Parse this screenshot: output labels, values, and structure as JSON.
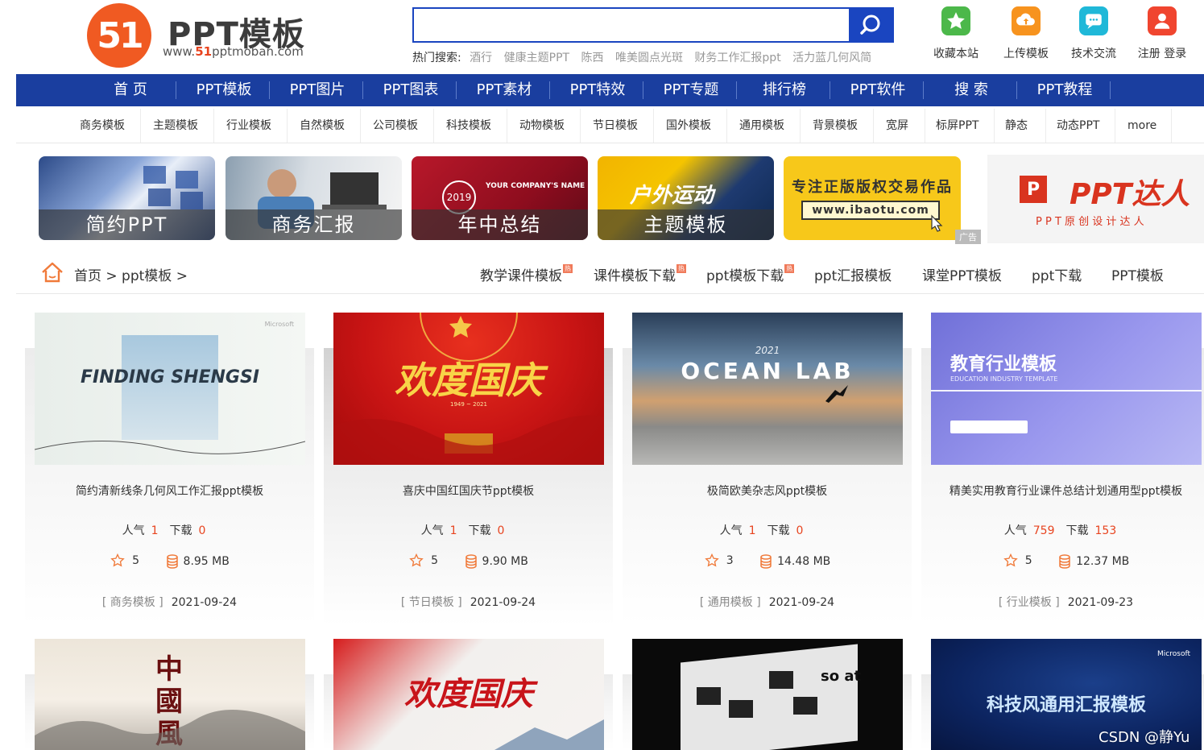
{
  "logo": {
    "mark": "51",
    "title": "PPT模板",
    "url_prefix": "www.",
    "url_highlight": "51",
    "url_suffix": "pptmoban.com"
  },
  "search": {
    "placeholder": "",
    "value": ""
  },
  "hot": {
    "label": "热门搜索:",
    "keywords": [
      "酒行",
      "健康主题PPT",
      "陈西",
      "唯美圆点光斑",
      "财务工作汇报ppt",
      "活力蓝几何风简"
    ]
  },
  "top_links": [
    {
      "label": "收藏本站",
      "icon": "star-icon",
      "color": "#4cb84a"
    },
    {
      "label": "上传模板",
      "icon": "upload-icon",
      "color": "#f7931e"
    },
    {
      "label": "技术交流",
      "icon": "chat-icon",
      "color": "#1fb8d8"
    },
    {
      "label": "注册 登录",
      "icon": "user-icon",
      "color": "#f0452f"
    }
  ],
  "main_nav": [
    "首 页",
    "PPT模板",
    "PPT图片",
    "PPT图表",
    "PPT素材",
    "PPT特效",
    "PPT专题",
    "排行榜",
    "PPT软件",
    "搜 索",
    "PPT教程"
  ],
  "sub_nav": [
    "商务模板",
    "主题模板",
    "行业模板",
    "自然模板",
    "公司模板",
    "科技模板",
    "动物模板",
    "节日模板",
    "国外模板",
    "通用模板",
    "背景模板",
    "宽屏",
    "标屏PPT",
    "静态",
    "动态PPT",
    "more"
  ],
  "banners": [
    {
      "caption": "简约PPT"
    },
    {
      "caption": "商务汇报"
    },
    {
      "caption": "年中总结",
      "badge": "2019",
      "sub": "YOUR COMPANY'S NAME"
    },
    {
      "caption": "主题模板",
      "sub": "户外运动"
    },
    {
      "line1": "专注正版版权交易作品",
      "line2": "www.ibaotu.com",
      "ad": "广告"
    },
    {
      "brand": "PPT达人",
      "sub": "P P T 原 创 设 计 达 人"
    }
  ],
  "breadcrumb": {
    "path": "首页 > ppt模板 >"
  },
  "keyword_links": [
    {
      "text": "教学课件模板",
      "hot": "热"
    },
    {
      "text": "课件模板下载",
      "hot": "热"
    },
    {
      "text": "ppt模板下载",
      "hot": "热"
    },
    {
      "text": "ppt汇报模板",
      "hot": ""
    },
    {
      "text": "课堂PPT模板",
      "hot": ""
    },
    {
      "text": "ppt下载",
      "hot": ""
    },
    {
      "text": "PPT模板",
      "hot": ""
    }
  ],
  "cards": [
    {
      "title": "简约清新线条几何风工作汇报ppt模板",
      "pop_label": "人气",
      "pop": "1",
      "dl_label": "下载",
      "dl": "0",
      "stars": "5",
      "size": "8.95 MB",
      "category": "[ 商务模板 ]",
      "date": "2021-09-24",
      "thumb_text": "FINDING  SHENGSI",
      "thumb_small": "Microsoft"
    },
    {
      "title": "喜庆中国红国庆节ppt模板",
      "pop_label": "人气",
      "pop": "1",
      "dl_label": "下载",
      "dl": "0",
      "stars": "5",
      "size": "9.90 MB",
      "category": "[ 节日模板 ]",
      "date": "2021-09-24",
      "thumb_text": "欢度国庆",
      "thumb_small": "1949 ~ 2021"
    },
    {
      "title": "极简欧美杂志风ppt模板",
      "pop_label": "人气",
      "pop": "1",
      "dl_label": "下载",
      "dl": "0",
      "stars": "3",
      "size": "14.48 MB",
      "category": "[ 通用模板 ]",
      "date": "2021-09-24",
      "thumb_text": "OCEAN LAB",
      "thumb_small": "2021"
    },
    {
      "title": "精美实用教育行业课件总结计划通用型ppt模板",
      "pop_label": "人气",
      "pop": "759",
      "dl_label": "下载",
      "dl": "153",
      "stars": "5",
      "size": "12.37 MB",
      "category": "[ 行业模板 ]",
      "date": "2021-09-23",
      "thumb_text": "教育行业模板",
      "thumb_small": "EDUCATION INDUSTRY TEMPLATE"
    },
    {
      "thumb_text": "中國風"
    },
    {
      "thumb_text": "欢度国庆"
    },
    {
      "thumb_text": "so at"
    },
    {
      "thumb_text": "科技风通用汇报模板",
      "thumb_small": "Microsoft"
    }
  ],
  "watermark": "CSDN @静Yu"
}
